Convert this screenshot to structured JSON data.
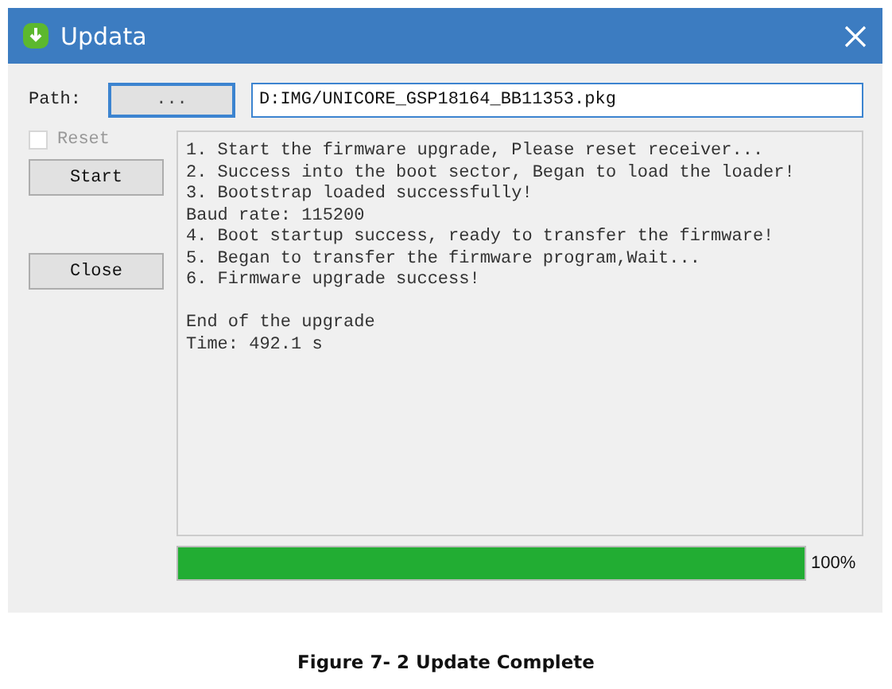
{
  "window": {
    "title": "Updata"
  },
  "path": {
    "label": "Path:",
    "browse_button": "...",
    "value": "D:IMG/UNICORE_GSP18164_BB11353.pkg"
  },
  "reset": {
    "label": "Reset",
    "checked": false,
    "disabled": true
  },
  "buttons": [
    {
      "label": "Start"
    },
    {
      "label": "Close"
    }
  ],
  "log": [
    [
      "1. Start the firmware upgrade, Please reset receiver...",
      "2. Success into the boot sector, Began to load the loader!",
      "3. Bootstrap loaded successfully!",
      "Baud rate: 115200",
      "4. Boot startup success, ready to transfer the firmware!",
      "5. Began to transfer the firmware program,Wait...",
      "6. Firmware upgrade success!"
    ],
    [
      "End of the upgrade",
      "Time: 492.1 s"
    ]
  ],
  "progress": {
    "level": 1,
    "reading": "100%"
  },
  "caption": "Figure 7- 2 Update Complete"
}
